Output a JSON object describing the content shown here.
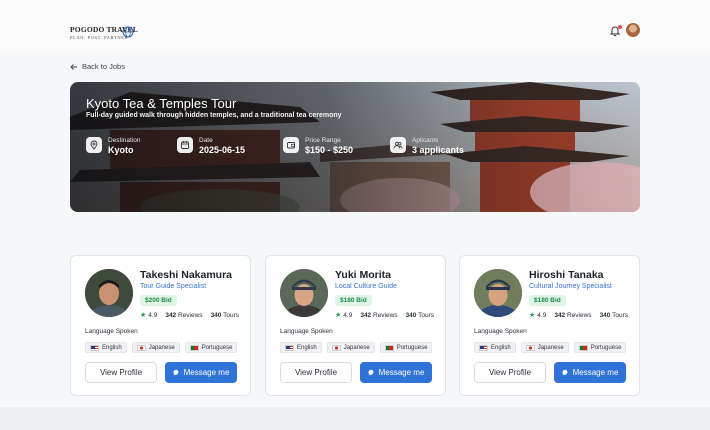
{
  "brand": {
    "name": "POGODO TRAVEL",
    "tagline": "PLAN. POST. PARTNER"
  },
  "nav": {
    "back_label": "Back to Jobs"
  },
  "job": {
    "title": "Kyoto Tea & Temples Tour",
    "subtitle": "Full-day guided walk through hidden temples, and a traditional tea ceremony",
    "info": [
      {
        "icon": "location-pin-icon",
        "label": "Destination",
        "value": "Kyoto"
      },
      {
        "icon": "calendar-icon",
        "label": "Date",
        "value": "2025-06-15"
      },
      {
        "icon": "wallet-icon",
        "label": "Price Range",
        "value": "$150 - $250"
      },
      {
        "icon": "users-icon",
        "label": "Aplicants",
        "value": "3 applicants"
      }
    ]
  },
  "guides": [
    {
      "name": "Takeshi Nakamura",
      "role": "Tour Guide Specialist",
      "bid": "$200 Bid",
      "rating": "4.9",
      "reviews": "342",
      "reviews_label": "Reviews",
      "tours": "340",
      "tours_label": "Tours",
      "language_label": "Language Spoken",
      "languages": [
        "English",
        "Japanese",
        "Portuguese"
      ],
      "view_label": "View Profile",
      "message_label": "Message me"
    },
    {
      "name": "Yuki Morita",
      "role": "Local Culture Guide",
      "bid": "$180 Bid",
      "rating": "4.9",
      "reviews": "342",
      "reviews_label": "Reviews",
      "tours": "340",
      "tours_label": "Tours",
      "language_label": "Language Spoken",
      "languages": [
        "English",
        "Japanese",
        "Portuguese"
      ],
      "view_label": "View Profile",
      "message_label": "Message me"
    },
    {
      "name": "Hiroshi Tanaka",
      "role": "Cultural Journey Specialist",
      "bid": "$180 Bid",
      "rating": "4.9",
      "reviews": "342",
      "reviews_label": "Reviews",
      "tours": "340",
      "tours_label": "Tours",
      "language_label": "Language Spoken",
      "languages": [
        "English",
        "Japanese",
        "Portuguese"
      ],
      "view_label": "View Profile",
      "message_label": "Message me"
    }
  ],
  "colors": {
    "accent": "#2f73d9",
    "bid_green": "#1f8a4c",
    "role_blue": "#3a6fd8"
  }
}
